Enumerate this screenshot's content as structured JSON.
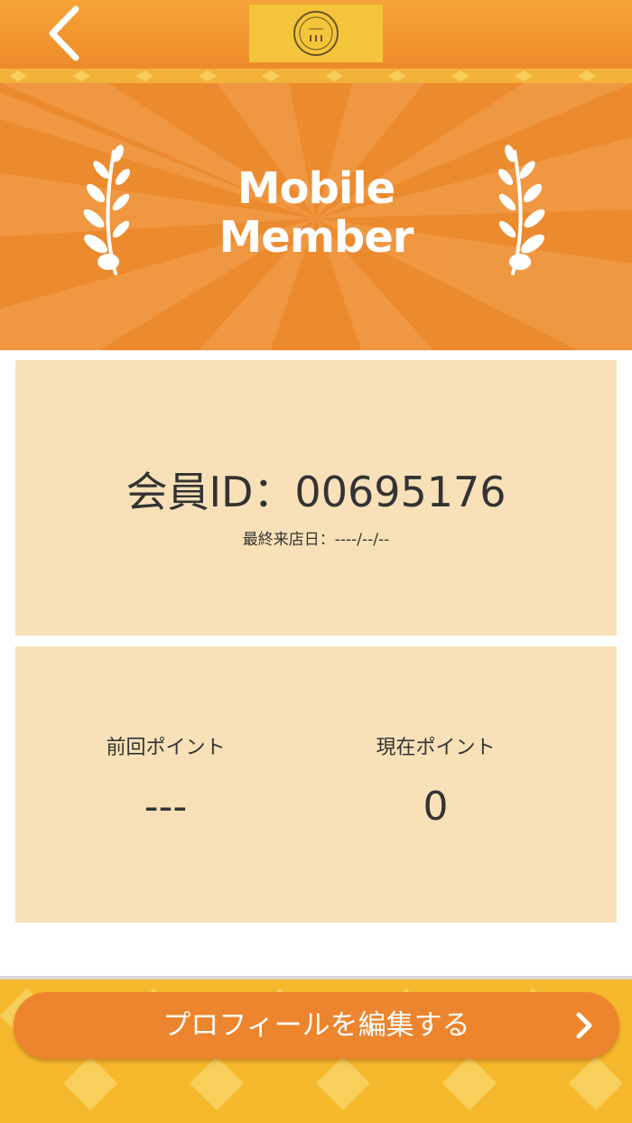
{
  "header": {
    "back_icon": "chevron-left-icon",
    "logo_icon": "shop-logo-icon",
    "logo_text": "III"
  },
  "hero": {
    "title_line1": "Mobile",
    "title_line2": "Member",
    "decor_icon": "laurel-icon"
  },
  "member_card": {
    "member_id_text": "会員ID：00695176",
    "last_visit_text": "最終来店日：----/--/--"
  },
  "points_card": {
    "previous_label": "前回ポイント",
    "previous_value": "---",
    "current_label": "現在ポイント",
    "current_value": "0"
  },
  "footer": {
    "edit_profile_label": "プロフィールを編集する",
    "edit_chevron_icon": "chevron-right-icon"
  },
  "colors": {
    "brand_orange": "#ec8a2e",
    "card_bg": "#f8e1b8",
    "accent_yellow": "#f4c53a"
  }
}
